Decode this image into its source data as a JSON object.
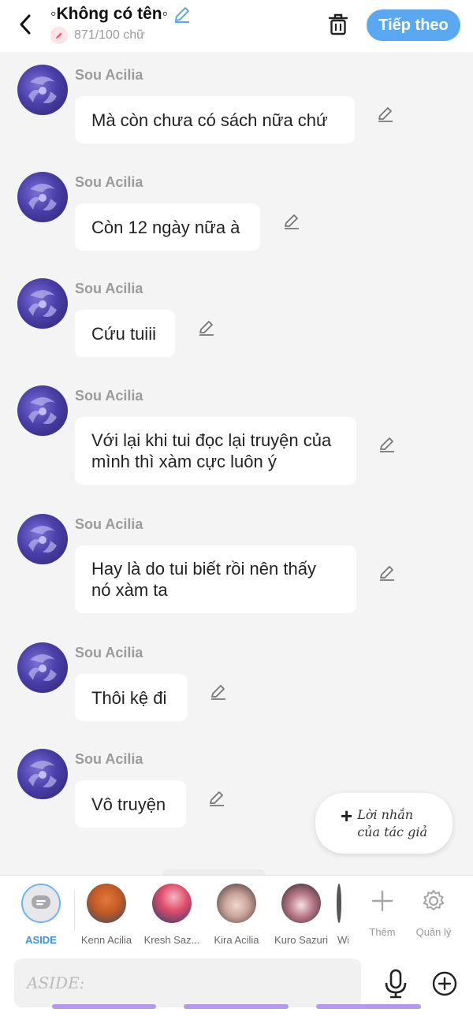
{
  "header": {
    "title": "◦Không có tên◦",
    "word_count": "871/100 chữ",
    "next_label": "Tiếp theo"
  },
  "messages": [
    {
      "sender": "Sou Acilia",
      "text": "Mà còn chưa có sách nữa chứ"
    },
    {
      "sender": "Sou Acilia",
      "text": "Còn 12 ngày nữa à"
    },
    {
      "sender": "Sou Acilia",
      "text": "Cứu tuiii"
    },
    {
      "sender": "Sou Acilia",
      "text": "Với lại khi tui đọc lại truyện của mình thì xàm cực luôn ý"
    },
    {
      "sender": "Sou Acilia",
      "text": "Hay là do tui biết rồi nên thấy nó xàm ta"
    },
    {
      "sender": "Sou Acilia",
      "text": "Thôi kệ đi"
    },
    {
      "sender": "Sou Acilia",
      "text": "Vô truyện"
    }
  ],
  "author_note": {
    "label": "Lời nhắn của tác giả"
  },
  "characters": {
    "aside": "ASIDE",
    "items": [
      {
        "name": "Kenn Acilia"
      },
      {
        "name": "Kresh Saz..."
      },
      {
        "name": "Kira Acilia"
      },
      {
        "name": "Kuro Sazuri"
      },
      {
        "name": "Wi"
      }
    ],
    "more_label": "Thêm",
    "manage_label": "Quản lý"
  },
  "input": {
    "placeholder": "ASIDE:"
  },
  "colors": {
    "accent": "#5aa8f2",
    "tab_indicator": "#b798ee",
    "avatar": "#4a3fa8"
  }
}
